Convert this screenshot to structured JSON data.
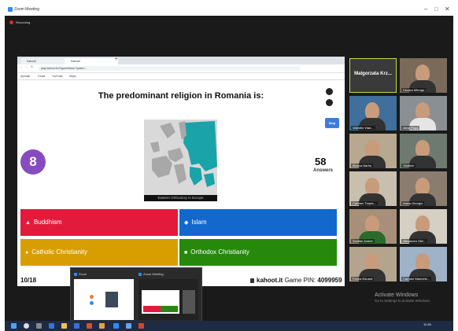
{
  "window": {
    "title": "Zoom Meeting",
    "minimize": "–",
    "maximize": "□",
    "close": "✕"
  },
  "recording": {
    "label": "Recording"
  },
  "browser": {
    "tabs": [
      {
        "label": "Kahoot!"
      },
      {
        "label": "Kahoot!"
      }
    ],
    "new_tab": "+",
    "url": "play.kahoot.it/v2/gameblock?quizId=...",
    "bookmarks": [
      {
        "label": "Aplicații"
      },
      {
        "label": "Gmail"
      },
      {
        "label": "YouTube"
      },
      {
        "label": "Maps"
      }
    ]
  },
  "kahoot": {
    "question": "The predominant religion in Romania is:",
    "skip_label": "Skip",
    "timer": "8",
    "answers_count": "58",
    "answers_label": "Answers",
    "map_caption": "Eastern Orthodoxy in Europe",
    "options": [
      {
        "symbol": "▲",
        "label": "Buddhism",
        "color": "#e21b3c"
      },
      {
        "symbol": "◆",
        "label": "Islam",
        "color": "#1368ce"
      },
      {
        "symbol": "●",
        "label": "Catholic Christianity",
        "color": "#d89e00"
      },
      {
        "symbol": "■",
        "label": "Orthodox Christianity",
        "color": "#26890c"
      }
    ],
    "progress": "10/18",
    "site": "kahoot.it",
    "pin_label": "Game PIN:",
    "pin": "4099959"
  },
  "thumbnails": [
    {
      "label": "Zoom"
    },
    {
      "label": "Zoom Meeting"
    }
  ],
  "participants": [
    {
      "name": "Malgorzata Krz..."
    },
    {
      "name": "Cezara Mitroga"
    },
    {
      "name": "Valentin Vlad..."
    },
    {
      "name": "Alina Popa"
    },
    {
      "name": "Bianca Barbu"
    },
    {
      "name": "Vladimir"
    },
    {
      "name": "Carmen Trepte..."
    },
    {
      "name": "Ioana Georgiu"
    },
    {
      "name": "Svetlan Andrei"
    },
    {
      "name": "Alexandru Sibi..."
    },
    {
      "name": "Florea Eduard"
    },
    {
      "name": "Carmen Mareche..."
    }
  ],
  "activate": {
    "title": "Activate Windows",
    "sub": "Go to Settings to activate Windows."
  },
  "taskbar": {
    "time": "11:26"
  }
}
